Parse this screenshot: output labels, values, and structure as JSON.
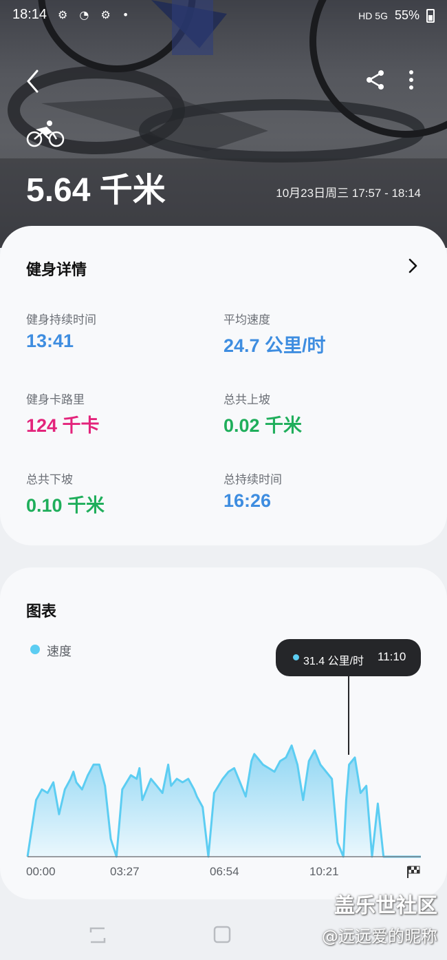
{
  "status_bar": {
    "time": "18:14",
    "left_icons": "⚙ ◔ ⚙ •",
    "network": "HD 5G",
    "battery": "55%"
  },
  "header": {
    "distance": "5.64 千米",
    "date_range": "10月23日周三 17:57 - 18:14"
  },
  "details": {
    "title": "健身详情",
    "stats": [
      {
        "label": "健身持续时间",
        "value": "13:41",
        "color": "#3e8de0"
      },
      {
        "label": "平均速度",
        "value": "24.7 公里/时",
        "color": "#3e8de0"
      },
      {
        "label": "健身卡路里",
        "value": "124 千卡",
        "color": "#e3237b"
      },
      {
        "label": "总共上坡",
        "value": "0.02 千米",
        "color": "#1fae5b"
      },
      {
        "label": "总共下坡",
        "value": "0.10 千米",
        "color": "#1fae5b"
      },
      {
        "label": "总持续时间",
        "value": "16:26",
        "color": "#3e8de0"
      }
    ]
  },
  "chart": {
    "title": "图表",
    "legend": "速度",
    "tooltip": {
      "speed": "31.4 公里/时",
      "time": "11:10"
    },
    "x_ticks": [
      "00:00",
      "03:27",
      "06:54",
      "10:21"
    ],
    "accent": "#5ccdf2"
  },
  "chart_data": {
    "type": "area",
    "series": [
      {
        "name": "速度"
      }
    ],
    "x_ticks": [
      "00:00",
      "03:27",
      "06:54",
      "10:21"
    ],
    "x_minutes": [
      0,
      0.3,
      0.5,
      0.7,
      0.9,
      1.1,
      1.3,
      1.5,
      1.6,
      1.7,
      1.9,
      2.1,
      2.3,
      2.5,
      2.7,
      2.9,
      3.1,
      3.3,
      3.6,
      3.8,
      3.9,
      4.0,
      4.1,
      4.3,
      4.5,
      4.7,
      4.9,
      5.0,
      5.2,
      5.4,
      5.6,
      5.8,
      5.9,
      6.1,
      6.3,
      6.5,
      6.8,
      7.0,
      7.2,
      7.4,
      7.6,
      7.8,
      7.9,
      8.0,
      8.2,
      8.4,
      8.6,
      8.8,
      9.0,
      9.2,
      9.4,
      9.6,
      9.8,
      10.0,
      10.2,
      10.4,
      10.6,
      10.8,
      11.0,
      11.1,
      11.2,
      11.4,
      11.6,
      11.8,
      12.0,
      12.2,
      12.4,
      12.6,
      12.8,
      13.0,
      13.2,
      13.4,
      13.7
    ],
    "speed_kmh": [
      0,
      16,
      19,
      18,
      21,
      12,
      19,
      22,
      24,
      21,
      19,
      23,
      26,
      26,
      20,
      5,
      0,
      19,
      23,
      22,
      25,
      16,
      18,
      22,
      20,
      18,
      26,
      20,
      22,
      21,
      22,
      19,
      17,
      14,
      0,
      18,
      22,
      24,
      25,
      21,
      17,
      27,
      29,
      28,
      26,
      25,
      24,
      27,
      28,
      31.4,
      26,
      16,
      27,
      30,
      26,
      24,
      22,
      4,
      0,
      16,
      26,
      28,
      18,
      20,
      0,
      15,
      0,
      0,
      0,
      0,
      0,
      0,
      0
    ],
    "ylim": [
      0,
      35
    ],
    "highlight": {
      "time": "11:10",
      "speed": 31.4
    }
  },
  "watermark": {
    "line1": "盖乐世社区",
    "line2": "@远远爱的昵称"
  }
}
